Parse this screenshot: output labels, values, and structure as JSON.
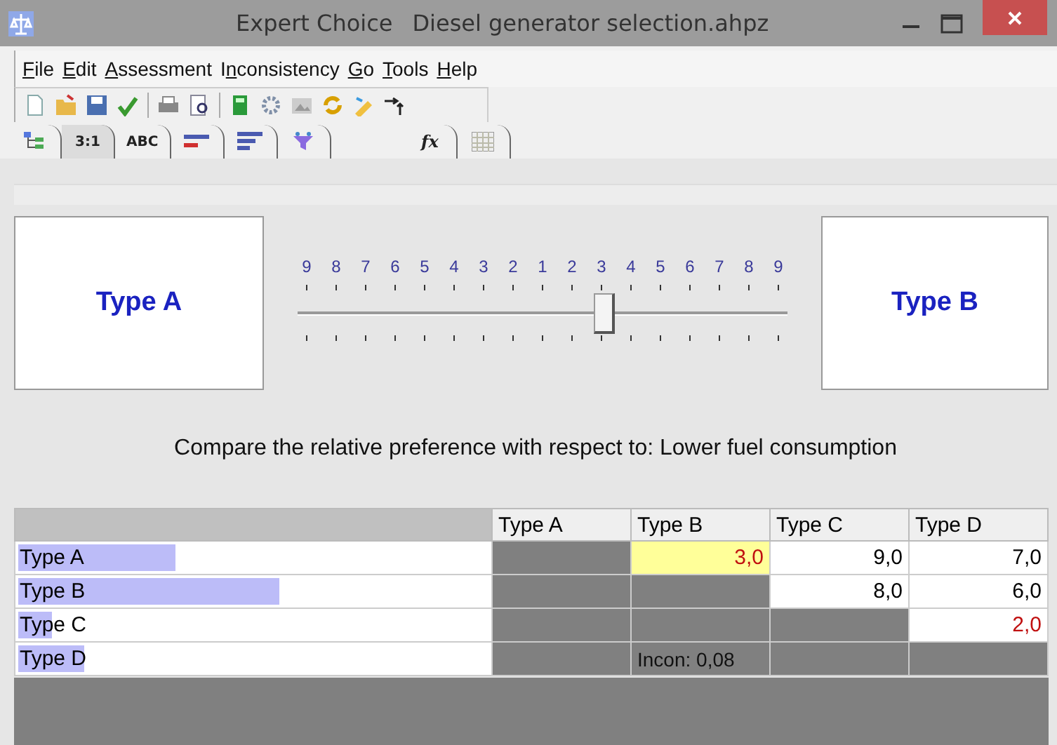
{
  "window": {
    "app": "Expert Choice",
    "document": "Diesel generator selection.ahpz"
  },
  "menu": [
    {
      "key": "F",
      "rest": "ile"
    },
    {
      "key": "E",
      "rest": "dit"
    },
    {
      "key": "A",
      "rest": "ssessment"
    },
    {
      "lead": "I",
      "key": "n",
      "rest": "consistency"
    },
    {
      "key": "G",
      "rest": "o"
    },
    {
      "key": "T",
      "rest": "ools"
    },
    {
      "key": "H",
      "rest": "elp"
    }
  ],
  "tabs": [
    {
      "kind": "tree",
      "selected": false
    },
    {
      "kind": "text",
      "label": "3:1",
      "selected": true
    },
    {
      "kind": "text",
      "label": "ABC",
      "selected": false
    },
    {
      "kind": "bars-red",
      "selected": false
    },
    {
      "kind": "bars",
      "selected": false
    },
    {
      "kind": "funnel",
      "selected": false
    },
    {
      "kind": "formula",
      "label": "fx",
      "selected": false
    },
    {
      "kind": "grid",
      "selected": false
    }
  ],
  "comparison": {
    "left": "Type A",
    "right": "Type B",
    "scale": [
      "9",
      "8",
      "7",
      "6",
      "5",
      "4",
      "3",
      "2",
      "1",
      "2",
      "3",
      "4",
      "5",
      "6",
      "7",
      "8",
      "9"
    ],
    "level": 0.625
  },
  "question": "Compare the relative preference with respect to: Lower fuel consumption",
  "matrix": {
    "columns": [
      "Type A",
      "Type B",
      "Type C",
      "Type D"
    ],
    "rows": [
      {
        "name": "Type A",
        "level": 0.33,
        "cells": [
          {
            "kind": "gray"
          },
          {
            "kind": "value",
            "text": "3,0",
            "inverted": true,
            "selected": true
          },
          {
            "kind": "value",
            "text": "9,0",
            "inverted": false,
            "selected": false
          },
          {
            "kind": "value",
            "text": "7,0",
            "inverted": false,
            "selected": false
          }
        ]
      },
      {
        "name": "Type B",
        "level": 0.55,
        "cells": [
          {
            "kind": "gray"
          },
          {
            "kind": "gray"
          },
          {
            "kind": "value",
            "text": "8,0",
            "inverted": false,
            "selected": false
          },
          {
            "kind": "value",
            "text": "6,0",
            "inverted": false,
            "selected": false
          }
        ]
      },
      {
        "name": "Type C",
        "level": 0.07,
        "cells": [
          {
            "kind": "gray"
          },
          {
            "kind": "gray"
          },
          {
            "kind": "gray"
          },
          {
            "kind": "value",
            "text": "2,0",
            "inverted": true,
            "selected": false
          }
        ]
      },
      {
        "name": "Type D",
        "level": 0.14,
        "cells": [
          {
            "kind": "gray"
          },
          {
            "kind": "note",
            "text": "Incon: 0,08"
          },
          {
            "kind": "gray"
          },
          {
            "kind": "gray"
          }
        ]
      }
    ]
  }
}
